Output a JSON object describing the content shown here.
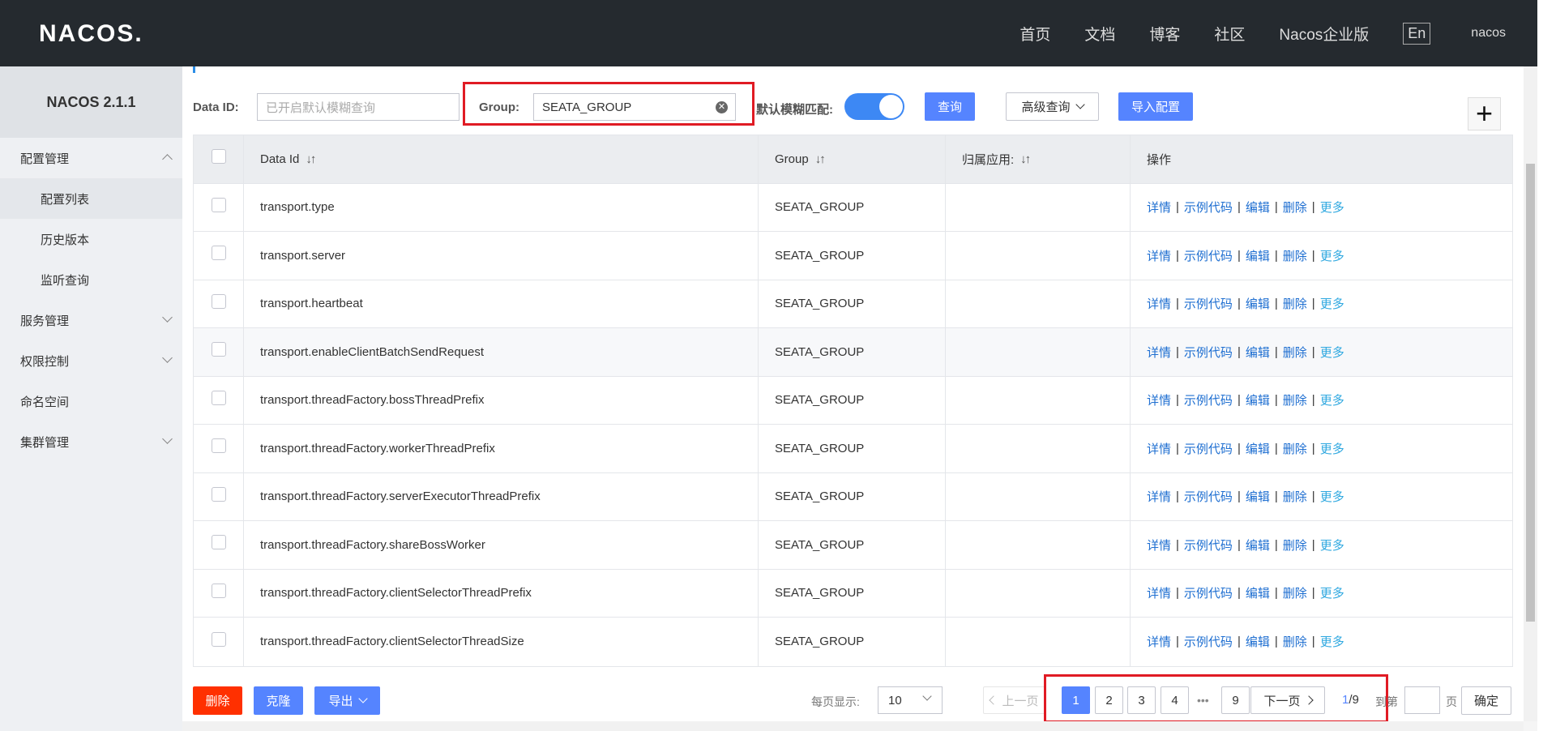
{
  "header": {
    "logo": "NACOS.",
    "nav": [
      "首页",
      "文档",
      "博客",
      "社区",
      "Nacos企业版"
    ],
    "lang": "En",
    "user": "nacos"
  },
  "sidebar": {
    "version": "NACOS 2.1.1",
    "items": [
      {
        "label": "配置管理"
      },
      {
        "label": "配置列表"
      },
      {
        "label": "历史版本"
      },
      {
        "label": "监听查询"
      },
      {
        "label": "服务管理"
      },
      {
        "label": "权限控制"
      },
      {
        "label": "命名空间"
      },
      {
        "label": "集群管理"
      }
    ]
  },
  "search": {
    "dataid_label": "Data ID:",
    "dataid_placeholder": "已开启默认模糊查询",
    "group_label": "Group:",
    "group_value": "SEATA_GROUP",
    "fuzzy_label": "默认模糊匹配:",
    "query_button": "查询",
    "advanced_button": "高级查询",
    "import_button": "导入配置"
  },
  "table": {
    "headers": [
      "Data Id",
      "Group",
      "归属应用:",
      "操作"
    ],
    "ops": [
      "详情",
      "示例代码",
      "编辑",
      "删除",
      "更多"
    ],
    "rows": [
      {
        "data_id": "transport.type",
        "group": "SEATA_GROUP",
        "app": ""
      },
      {
        "data_id": "transport.server",
        "group": "SEATA_GROUP",
        "app": ""
      },
      {
        "data_id": "transport.heartbeat",
        "group": "SEATA_GROUP",
        "app": ""
      },
      {
        "data_id": "transport.enableClientBatchSendRequest",
        "group": "SEATA_GROUP",
        "app": ""
      },
      {
        "data_id": "transport.threadFactory.bossThreadPrefix",
        "group": "SEATA_GROUP",
        "app": ""
      },
      {
        "data_id": "transport.threadFactory.workerThreadPrefix",
        "group": "SEATA_GROUP",
        "app": ""
      },
      {
        "data_id": "transport.threadFactory.serverExecutorThreadPrefix",
        "group": "SEATA_GROUP",
        "app": ""
      },
      {
        "data_id": "transport.threadFactory.shareBossWorker",
        "group": "SEATA_GROUP",
        "app": ""
      },
      {
        "data_id": "transport.threadFactory.clientSelectorThreadPrefix",
        "group": "SEATA_GROUP",
        "app": ""
      },
      {
        "data_id": "transport.threadFactory.clientSelectorThreadSize",
        "group": "SEATA_GROUP",
        "app": ""
      }
    ]
  },
  "footer": {
    "delete_button": "删除",
    "clone_button": "克隆",
    "export_button": "导出",
    "page_size_label": "每页显示:",
    "page_size": "10",
    "prev": "上一页",
    "pages": [
      "1",
      "2",
      "3",
      "4",
      "9"
    ],
    "ellipsis": "•••",
    "next": "下一页",
    "current": "1",
    "total": "/9",
    "goto_label": "到第",
    "page_unit": "页",
    "confirm": "确定"
  },
  "colors": {
    "header_bg": "#252a2f",
    "primary": "#5584ff",
    "danger": "#ff3000",
    "link": "#1f6fd1",
    "highlight_box": "#e01b24"
  }
}
